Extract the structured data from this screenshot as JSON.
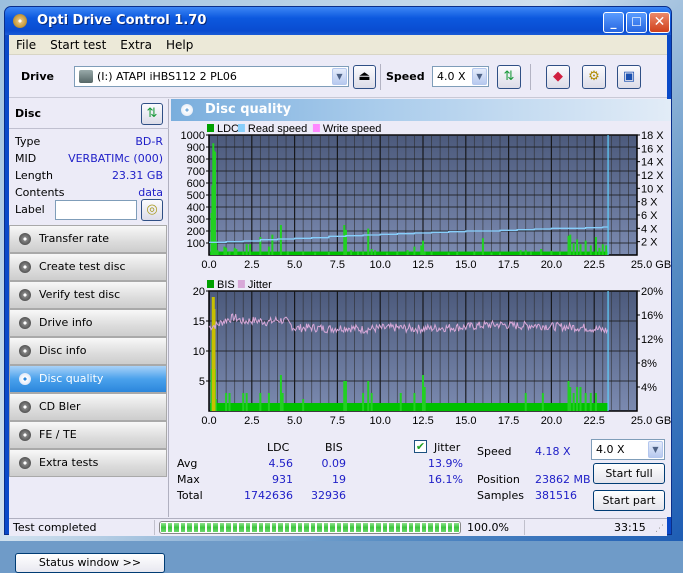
{
  "window": {
    "title": "Opti Drive Control 1.70",
    "buttons": {
      "minimize": "_",
      "maximize": "☐",
      "close": "✕"
    }
  },
  "menu": [
    {
      "label": "File",
      "key": "F"
    },
    {
      "label": "Start test",
      "key": "S"
    },
    {
      "label": "Extra",
      "key": "x"
    },
    {
      "label": "Help",
      "key": "H"
    }
  ],
  "toolbar": {
    "drive_label": "Drive",
    "drive_value": "(I:)   ATAPI iHBS112   2 PL06",
    "speed_label": "Speed",
    "speed_value": "4.0 X",
    "icons": [
      "eject-icon",
      "refresh-icon",
      "erase-icon",
      "settings-icon",
      "save-icon"
    ]
  },
  "disc": {
    "header": "Disc",
    "fields": [
      {
        "key": "Type",
        "value": "BD-R"
      },
      {
        "key": "MID",
        "value": "VERBATIMc (000)"
      },
      {
        "key": "Length",
        "value": "23.31 GB"
      },
      {
        "key": "Contents",
        "value": "data"
      }
    ],
    "label_key": "Label",
    "label_value": ""
  },
  "nav": [
    {
      "label": "Transfer rate",
      "active": false
    },
    {
      "label": "Create test disc",
      "active": false
    },
    {
      "label": "Verify test disc",
      "active": false
    },
    {
      "label": "Drive info",
      "active": false
    },
    {
      "label": "Disc info",
      "active": false
    },
    {
      "label": "Disc quality",
      "active": true
    },
    {
      "label": "CD Bler",
      "active": false
    },
    {
      "label": "FE / TE",
      "active": false
    },
    {
      "label": "Extra tests",
      "active": false
    }
  ],
  "status_window_button": "Status window >>",
  "panel": {
    "title": "Disc quality"
  },
  "chart_data": [
    {
      "type": "bar",
      "title": "LDC / Read speed",
      "legend": [
        {
          "name": "LDC",
          "color": "#00a000"
        },
        {
          "name": "Read speed",
          "color": "#87cefa"
        },
        {
          "name": "Write speed",
          "color": "#ff88ff"
        }
      ],
      "legend_position": "top-left",
      "xlabel": "GB",
      "xlim": [
        0,
        25
      ],
      "x_ticks": [
        "0.0",
        "2.5",
        "5.0",
        "7.5",
        "10.0",
        "12.5",
        "15.0",
        "17.5",
        "20.0",
        "22.5",
        "25.0 GB"
      ],
      "ylim_left": [
        0,
        1000
      ],
      "y_ticks_left": [
        "100",
        "200",
        "300",
        "400",
        "500",
        "600",
        "700",
        "800",
        "900",
        "1000"
      ],
      "ylim_right": [
        0,
        18
      ],
      "y_ticks_right": [
        "2 X",
        "4 X",
        "6 X",
        "8 X",
        "10 X",
        "12 X",
        "14 X",
        "16 X",
        "18 X"
      ],
      "grid": true,
      "end_marker_gb": 23.31,
      "ldc_spikes": [
        [
          0.15,
          350
        ],
        [
          0.2,
          580
        ],
        [
          0.25,
          931
        ],
        [
          0.3,
          870
        ],
        [
          0.35,
          860
        ],
        [
          0.4,
          120
        ],
        [
          0.5,
          40
        ],
        [
          0.9,
          70
        ],
        [
          1.0,
          60
        ],
        [
          1.2,
          30
        ],
        [
          1.5,
          60
        ],
        [
          1.6,
          50
        ],
        [
          2.0,
          30
        ],
        [
          2.2,
          90
        ],
        [
          2.4,
          90
        ],
        [
          3.0,
          150
        ],
        [
          3.5,
          70
        ],
        [
          3.7,
          170
        ],
        [
          4.2,
          250
        ],
        [
          4.6,
          30
        ],
        [
          5.5,
          30
        ],
        [
          6.2,
          20
        ],
        [
          7.0,
          25
        ],
        [
          7.9,
          250
        ],
        [
          8.0,
          210
        ],
        [
          8.3,
          40
        ],
        [
          8.7,
          30
        ],
        [
          9.0,
          30
        ],
        [
          9.3,
          220
        ],
        [
          9.5,
          50
        ],
        [
          9.7,
          40
        ],
        [
          10.4,
          20
        ],
        [
          11.0,
          30
        ],
        [
          11.6,
          40
        ],
        [
          12.0,
          70
        ],
        [
          12.4,
          80
        ],
        [
          12.5,
          120
        ],
        [
          12.6,
          30
        ],
        [
          13.0,
          30
        ],
        [
          14.0,
          20
        ],
        [
          14.5,
          25
        ],
        [
          15.5,
          30
        ],
        [
          16.0,
          140
        ],
        [
          16.5,
          20
        ],
        [
          17.0,
          20
        ],
        [
          18.2,
          40
        ],
        [
          18.5,
          40
        ],
        [
          18.8,
          30
        ],
        [
          19.4,
          50
        ],
        [
          20.0,
          35
        ],
        [
          20.5,
          30
        ],
        [
          21.0,
          160
        ],
        [
          21.1,
          170
        ],
        [
          21.3,
          100
        ],
        [
          21.5,
          130
        ],
        [
          21.7,
          90
        ],
        [
          22.0,
          120
        ],
        [
          22.3,
          80
        ],
        [
          22.6,
          150
        ],
        [
          22.8,
          60
        ],
        [
          23.0,
          90
        ],
        [
          23.2,
          80
        ]
      ],
      "ldc_baseline": 12,
      "read_speed": {
        "x": [
          0,
          1.0,
          2.0,
          3.0,
          4.0,
          5.0,
          6.0,
          7.0,
          8.0,
          9.0,
          10.0,
          11.0,
          12.0,
          13.0,
          14.0,
          15.0,
          16.0,
          17.0,
          18.0,
          19.0,
          20.0,
          21.0,
          22.0,
          23.0,
          23.31
        ],
        "y": [
          1.9,
          2.0,
          2.1,
          2.3,
          2.4,
          2.5,
          2.6,
          2.8,
          2.9,
          3.0,
          3.1,
          3.2,
          3.3,
          3.4,
          3.5,
          3.6,
          3.6,
          3.7,
          3.8,
          3.9,
          4.0,
          4.0,
          4.1,
          4.2,
          4.2
        ]
      }
    },
    {
      "type": "bar",
      "title": "BIS / Jitter",
      "legend": [
        {
          "name": "BIS",
          "color": "#00a000"
        },
        {
          "name": "Jitter",
          "color": "#d8a8d8"
        }
      ],
      "legend_position": "top-left",
      "xlabel": "GB",
      "xlim": [
        0,
        25
      ],
      "x_ticks": [
        "0.0",
        "2.5",
        "5.0",
        "7.5",
        "10.0",
        "12.5",
        "15.0",
        "17.5",
        "20.0",
        "22.5",
        "25.0 GB"
      ],
      "ylim_left": [
        0,
        20
      ],
      "y_ticks_left": [
        "5",
        "10",
        "15",
        "20"
      ],
      "ylim_right": [
        0,
        20
      ],
      "y_ticks_right": [
        "4%",
        "8%",
        "12%",
        "16%",
        "20%"
      ],
      "grid": true,
      "end_marker_gb": 23.31,
      "bis_spikes": [
        [
          0.15,
          7
        ],
        [
          0.2,
          12
        ],
        [
          0.25,
          19
        ],
        [
          0.3,
          17
        ],
        [
          0.35,
          7
        ],
        [
          0.4,
          2
        ],
        [
          1.0,
          3
        ],
        [
          1.2,
          3
        ],
        [
          2.0,
          3
        ],
        [
          2.2,
          3
        ],
        [
          3.0,
          3
        ],
        [
          3.5,
          3
        ],
        [
          4.2,
          6
        ],
        [
          4.3,
          3
        ],
        [
          5.5,
          2
        ],
        [
          7.9,
          5
        ],
        [
          8.0,
          5
        ],
        [
          9.0,
          3
        ],
        [
          9.3,
          5
        ],
        [
          9.5,
          3
        ],
        [
          11.2,
          3
        ],
        [
          12.0,
          3
        ],
        [
          12.5,
          6
        ],
        [
          12.6,
          4
        ],
        [
          18.5,
          3
        ],
        [
          19.5,
          3
        ],
        [
          21.0,
          5
        ],
        [
          21.1,
          4
        ],
        [
          21.3,
          3
        ],
        [
          21.5,
          4
        ],
        [
          21.7,
          4
        ],
        [
          22.0,
          3
        ],
        [
          22.3,
          3
        ],
        [
          22.6,
          3
        ]
      ],
      "bis_highlight_yellow": [
        [
          0.22,
          19
        ],
        [
          0.28,
          19
        ],
        [
          0.32,
          17
        ]
      ],
      "bis_baseline": 1,
      "jitter_percent": {
        "x": [
          0,
          0.5,
          1.0,
          1.5,
          2.0,
          2.5,
          3.0,
          3.5,
          4.0,
          4.5,
          5.0,
          6.0,
          7.0,
          8.0,
          9.0,
          10.0,
          11.0,
          12.0,
          13.0,
          14.0,
          15.0,
          16.0,
          17.0,
          18.0,
          19.0,
          20.0,
          21.0,
          22.0,
          23.0,
          23.31
        ],
        "y": [
          14.0,
          14.4,
          15.2,
          15.6,
          14.9,
          15.1,
          15.0,
          14.8,
          15.2,
          15.0,
          13.8,
          13.9,
          13.7,
          13.9,
          13.6,
          13.8,
          13.9,
          13.7,
          13.8,
          13.9,
          14.0,
          14.3,
          14.4,
          14.2,
          14.3,
          14.1,
          14.0,
          13.9,
          13.5,
          13.4
        ]
      }
    }
  ],
  "stats": {
    "col_ldc": "LDC",
    "col_bis": "BIS",
    "jitter_label": "Jitter",
    "jitter_checked": true,
    "rows": [
      {
        "label": "Avg",
        "ldc": "4.56",
        "bis": "0.09",
        "jitter": "13.9%"
      },
      {
        "label": "Max",
        "ldc": "931",
        "bis": "19",
        "jitter": "16.1%"
      },
      {
        "label": "Total",
        "ldc": "1742636",
        "bis": "32936",
        "jitter": ""
      }
    ],
    "speed_label": "Speed",
    "speed_value": "4.18 X",
    "speed_select": "4.0 X",
    "position_label": "Position",
    "position_value": "23862 MB",
    "samples_label": "Samples",
    "samples_value": "381516",
    "start_full": "Start full",
    "start_part": "Start part"
  },
  "statusbar": {
    "text": "Test completed",
    "progress": 1.0,
    "progress_text": "100.0%",
    "time": "33:15"
  }
}
